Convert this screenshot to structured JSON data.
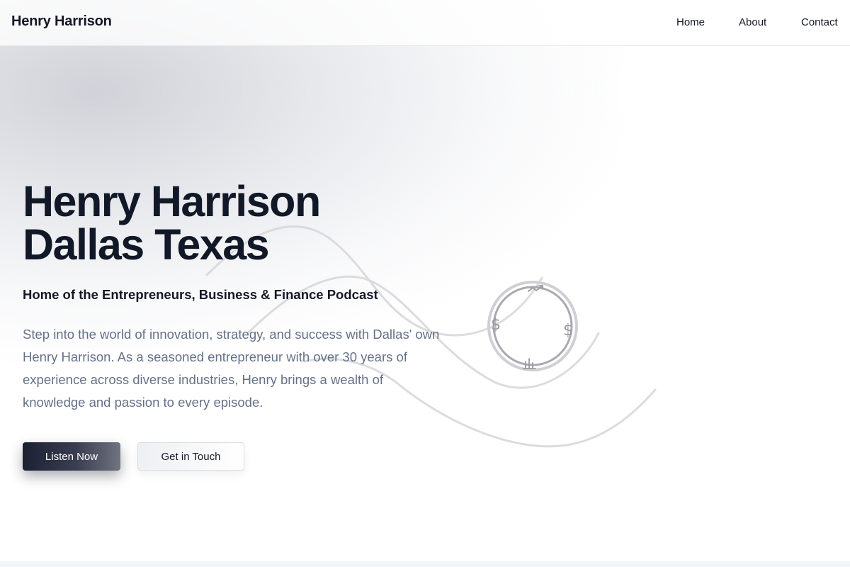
{
  "header": {
    "brand": "Henry Harrison",
    "nav": {
      "home": "Home",
      "about": "About",
      "contact": "Contact"
    }
  },
  "hero": {
    "title_line1": "Henry Harrison",
    "title_line2": "Dallas Texas",
    "subtitle": "Home of the Entrepreneurs, Business & Finance Podcast",
    "description": "Step into the world of innovation, strategy, and success with Dallas' own Henry Harrison. As a seasoned entrepreneur with over 30 years of experience across diverse industries, Henry brings a wealth of knowledge and passion to every episode.",
    "buttons": {
      "primary": "Listen Now",
      "secondary": "Get in Touch"
    }
  },
  "decoration": {
    "icons": [
      "dollar-icon",
      "dollar-icon",
      "trend-up-icon",
      "bar-chart-icon"
    ],
    "dollar_symbol": "$"
  },
  "colors": {
    "title": "#111827",
    "body_text": "#657187",
    "primary_button": "#1c2033",
    "header_border": "#e6e7eb"
  }
}
